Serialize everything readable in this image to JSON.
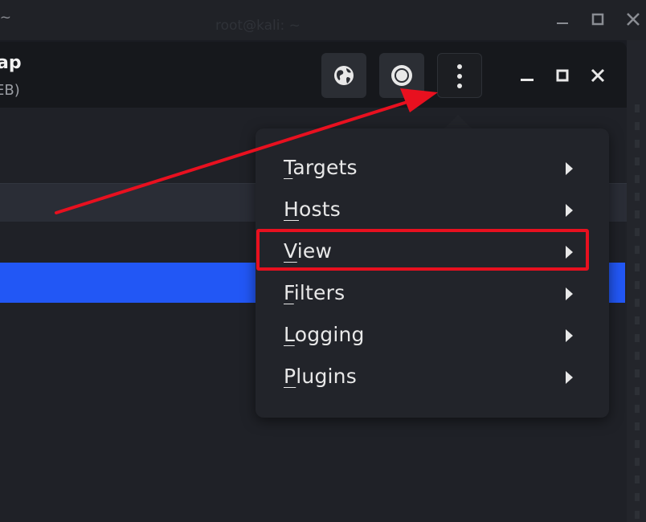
{
  "terminal": {
    "title_left": ":~",
    "title_center": "root@kali: ~"
  },
  "app": {
    "title": "ap",
    "subtitle": "EB)",
    "header_buttons": [
      {
        "icon": "globe-icon"
      },
      {
        "icon": "record-icon"
      },
      {
        "icon": "kebab-menu-icon"
      }
    ]
  },
  "menu": {
    "items": [
      {
        "label": "Targets"
      },
      {
        "label": "Hosts"
      },
      {
        "label": "View"
      },
      {
        "label": "Filters"
      },
      {
        "label": "Logging"
      },
      {
        "label": "Plugins"
      }
    ]
  },
  "colors": {
    "selection": "#2257f5",
    "annotation": "#e8101f"
  }
}
